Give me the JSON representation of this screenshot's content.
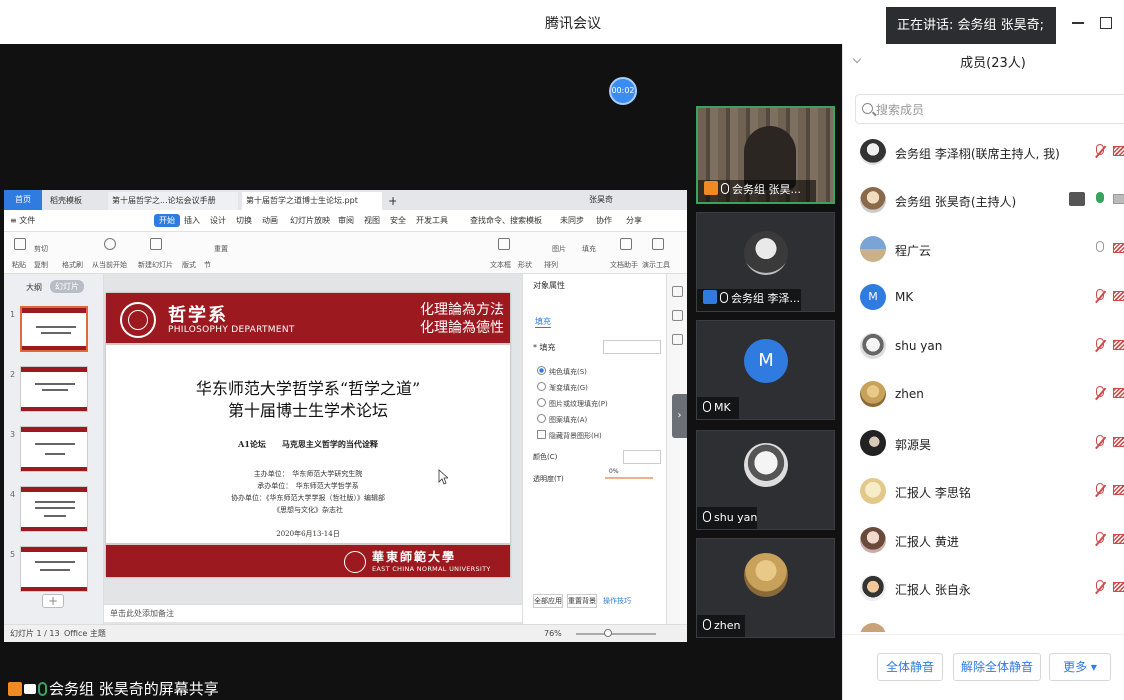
{
  "window": {
    "title": "腾讯会议",
    "speaking": "正在讲话: 会务组 张昊奇;",
    "timer": "00:02"
  },
  "share": {
    "label": "会务组 张昊奇的屏幕共享",
    "tabs": {
      "home": "首页",
      "t1": "稻壳模板",
      "t2": "第十届哲学之...论坛会议手册",
      "t3": "第十届哲学之道博士生论坛.ppt",
      "plus": "+"
    },
    "user": "张昊奇",
    "menu": [
      "≡ 文件",
      "开始",
      "插入",
      "设计",
      "切换",
      "动画",
      "幻灯片放映",
      "审阅",
      "视图",
      "安全",
      "开发工具",
      "查找命令、搜索模板",
      "未同步",
      "协作",
      "分享"
    ],
    "ribbon": [
      "粘贴",
      "剪切",
      "复制",
      "格式刷",
      "从当前开始",
      "新建幻灯片",
      "版式",
      "节",
      "重置",
      "文本框",
      "形状",
      "排列",
      "图片",
      "填充",
      "文档助手",
      "演示工具"
    ],
    "left_tabs": {
      "outline": "大纲",
      "thumbs": "幻灯片"
    },
    "slide_numbers": [
      "1",
      "2",
      "3",
      "4",
      "5"
    ],
    "slide": {
      "dept_cn": "哲学系",
      "dept_en": "PHILOSOPHY DEPARTMENT",
      "motto_1": "化理論為方法",
      "motto_2": "化理論為德性",
      "title_1": "华东师范大学哲学系“哲学之道”",
      "title_2": "第十届博士生学术论坛",
      "subtitle": "A1论坛　　马克思主义哲学的当代诠释",
      "org_1": "主办单位：　华东师范大学研究生院",
      "org_2": "承办单位：　华东师范大学哲学系",
      "org_3": "协办单位：《华东师范大学学报（哲社版）》编辑部",
      "org_4": "《思想与文化》杂志社",
      "date": "2020年6月13-14日",
      "univ_cn": "華東師範大學",
      "univ_en": "EAST CHINA NORMAL UNIVERSITY"
    },
    "prop": {
      "title": "对象属性",
      "fill_tab": "填充",
      "fill_label": "* 填充",
      "options": [
        "纯色填充(S)",
        "渐变填充(G)",
        "图片或纹理填充(P)",
        "图案填充(A)",
        "隐藏背景图形(H)"
      ],
      "color_label": "颜色(C)",
      "trans_label": "透明度(T)",
      "trans_value": "0%",
      "btn_all": "全部应用",
      "btn_reset": "重置背景",
      "tips": "操作技巧"
    },
    "notes": "单击此处添加备注",
    "status": {
      "slide": "幻灯片 1 / 13",
      "theme": "Office 主题",
      "zoom": "76%"
    }
  },
  "tiles": [
    {
      "name": "会务组 张昊..."
    },
    {
      "name": "会务组 李泽..."
    },
    {
      "name": "MK",
      "letter": "M"
    },
    {
      "name": "shu yan"
    },
    {
      "name": "zhen"
    }
  ],
  "panel": {
    "title": "成员(23人)",
    "search_placeholder": "搜索成员",
    "members": [
      {
        "name": "会务组 李泽栩(联席主持人, 我)"
      },
      {
        "name": "会务组 张昊奇(主持人)"
      },
      {
        "name": "程广云"
      },
      {
        "name": "MK",
        "letter": "M"
      },
      {
        "name": "shu yan"
      },
      {
        "name": "zhen"
      },
      {
        "name": "郭源昊"
      },
      {
        "name": "汇报人 李思铭"
      },
      {
        "name": "汇报人 黄进"
      },
      {
        "name": "汇报人 张自永"
      },
      {
        "name": ""
      }
    ],
    "buttons": {
      "mute_all": "全体静音",
      "unmute_all": "解除全体静音",
      "more": "更多 ▾"
    }
  },
  "colors": {
    "accent": "#2f7be0",
    "slide_red": "#9c1a1f",
    "muted": "#d04b4b"
  }
}
